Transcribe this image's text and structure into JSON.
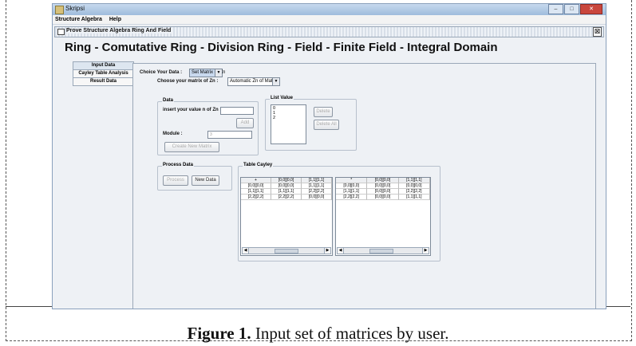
{
  "window": {
    "title": "Skripsi",
    "menu": [
      "Structure Algebra",
      "Help"
    ]
  },
  "internal_frame": {
    "title": "Prove Structure Algebra Ring And Field",
    "close": "⊠"
  },
  "heading": "Ring - Comutative Ring -  Division Ring -  Field - Finite Field - Integral Domain",
  "tabs": [
    "Input Data",
    "Cayley Table Analysis",
    "Result Data"
  ],
  "choice": {
    "label": "Choice Your Data :",
    "value": "Set Matrix of Zn"
  },
  "matrix": {
    "label": "Choose your matrix of Zn :",
    "value": "Automatic Zn of Matrix"
  },
  "data_group": {
    "title": "Data",
    "insert_label": "insert your value n of Zn :",
    "insert_value": "",
    "add": "Add",
    "module_label": "Module :",
    "module_value": "3",
    "create": "Create New Matrix"
  },
  "list_group": {
    "title": "List Value",
    "items": [
      "0",
      "1",
      "2"
    ],
    "delete": "Delete",
    "delete_all": "Delete All"
  },
  "process_group": {
    "title": "Process Data",
    "process": "Process",
    "new_data": "New Data"
  },
  "cayley": {
    "title": "Table Cayley",
    "table1": {
      "headers": [
        "+",
        "[0,0][0,0]",
        "[1,1][1,1]"
      ],
      "rows": [
        [
          "[0,0][0,0]",
          "[0,0][0,0]",
          "[1,1][1,1]"
        ],
        [
          "[1,1][1,1]",
          "[1,1][1,1]",
          "[2,2][2,2]"
        ],
        [
          "[2,2][2,2]",
          "[2,2][2,2]",
          "[0,0][0,0]"
        ]
      ]
    },
    "table2": {
      "headers": [
        "*",
        "[0,0][0,0]",
        "[1,1][1,1]"
      ],
      "rows": [
        [
          "[0,0][0,0]",
          "[0,0][0,0]",
          "[0,0][0,0]"
        ],
        [
          "[1,1][1,1]",
          "[0,0][0,0]",
          "[2,2][2,2]"
        ],
        [
          "[2,2][2,2]",
          "[0,0][0,0]",
          "[1,1][1,1]"
        ]
      ]
    }
  },
  "caption": {
    "bold": "Figure 1.",
    "text": " Input set of matrices by user."
  }
}
